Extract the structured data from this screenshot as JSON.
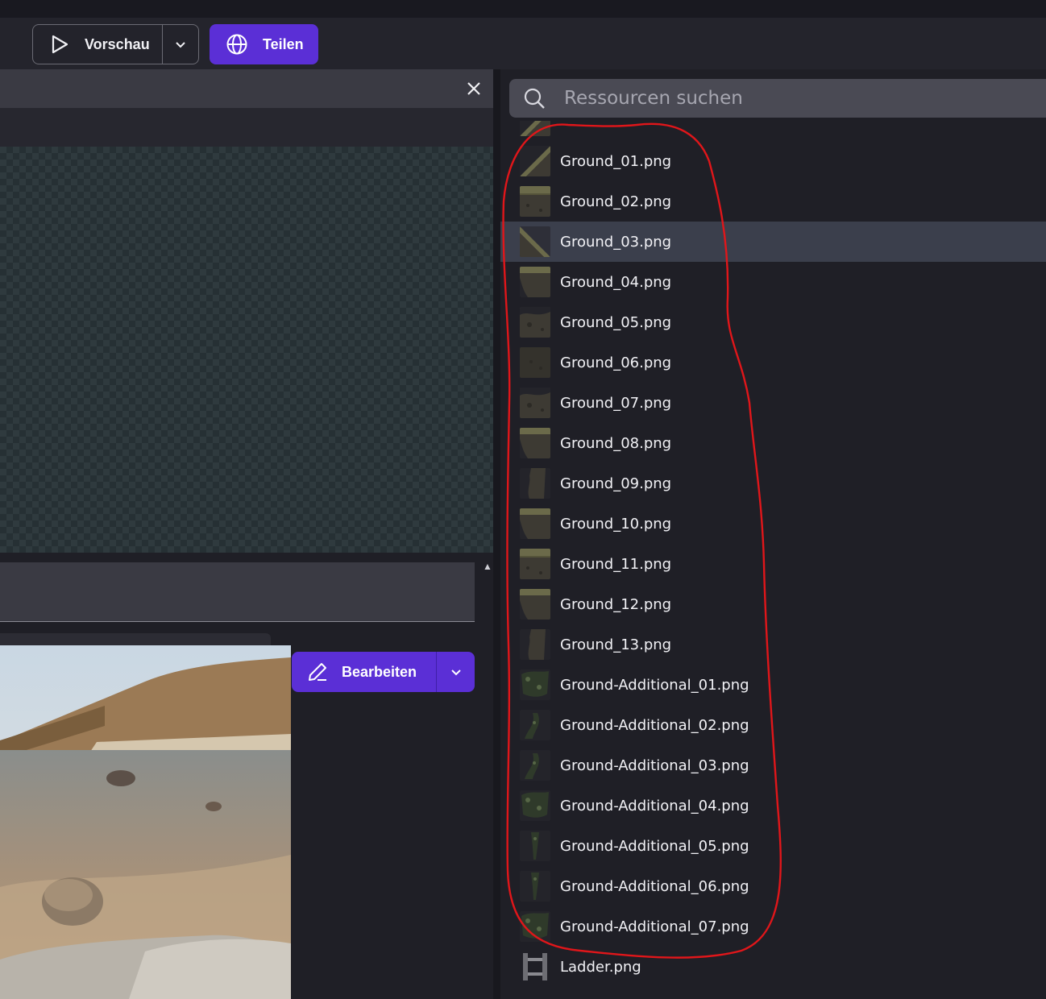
{
  "toolbar": {
    "preview_label": "Vorschau",
    "share_label": "Teilen"
  },
  "editor": {
    "edit_label": "Bearbeiten"
  },
  "resources": {
    "search_placeholder": "Ressourcen suchen",
    "selected_index": 3,
    "items": [
      {
        "label": "",
        "thumb": "ground-slope"
      },
      {
        "label": "Ground_01.png",
        "thumb": "ground-slope"
      },
      {
        "label": "Ground_02.png",
        "thumb": "ground-top"
      },
      {
        "label": "Ground_03.png",
        "thumb": "ground-slope-down"
      },
      {
        "label": "Ground_04.png",
        "thumb": "ground-corner"
      },
      {
        "label": "Ground_05.png",
        "thumb": "ground-fill"
      },
      {
        "label": "Ground_06.png",
        "thumb": "ground-dark"
      },
      {
        "label": "Ground_07.png",
        "thumb": "ground-fill"
      },
      {
        "label": "Ground_08.png",
        "thumb": "ground-corner"
      },
      {
        "label": "Ground_09.png",
        "thumb": "ground-pillar"
      },
      {
        "label": "Ground_10.png",
        "thumb": "ground-corner"
      },
      {
        "label": "Ground_11.png",
        "thumb": "ground-top"
      },
      {
        "label": "Ground_12.png",
        "thumb": "ground-corner"
      },
      {
        "label": "Ground_13.png",
        "thumb": "ground-pillar"
      },
      {
        "label": "Ground-Additional_01.png",
        "thumb": "moss"
      },
      {
        "label": "Ground-Additional_02.png",
        "thumb": "moss-thin"
      },
      {
        "label": "Ground-Additional_03.png",
        "thumb": "moss-thin"
      },
      {
        "label": "Ground-Additional_04.png",
        "thumb": "moss"
      },
      {
        "label": "Ground-Additional_05.png",
        "thumb": "moss-drip"
      },
      {
        "label": "Ground-Additional_06.png",
        "thumb": "moss-drip"
      },
      {
        "label": "Ground-Additional_07.png",
        "thumb": "moss"
      },
      {
        "label": "Ladder.png",
        "thumb": "ladder"
      }
    ]
  },
  "colors": {
    "accent": "#5b2fd6",
    "annotation": "#e0161a"
  }
}
